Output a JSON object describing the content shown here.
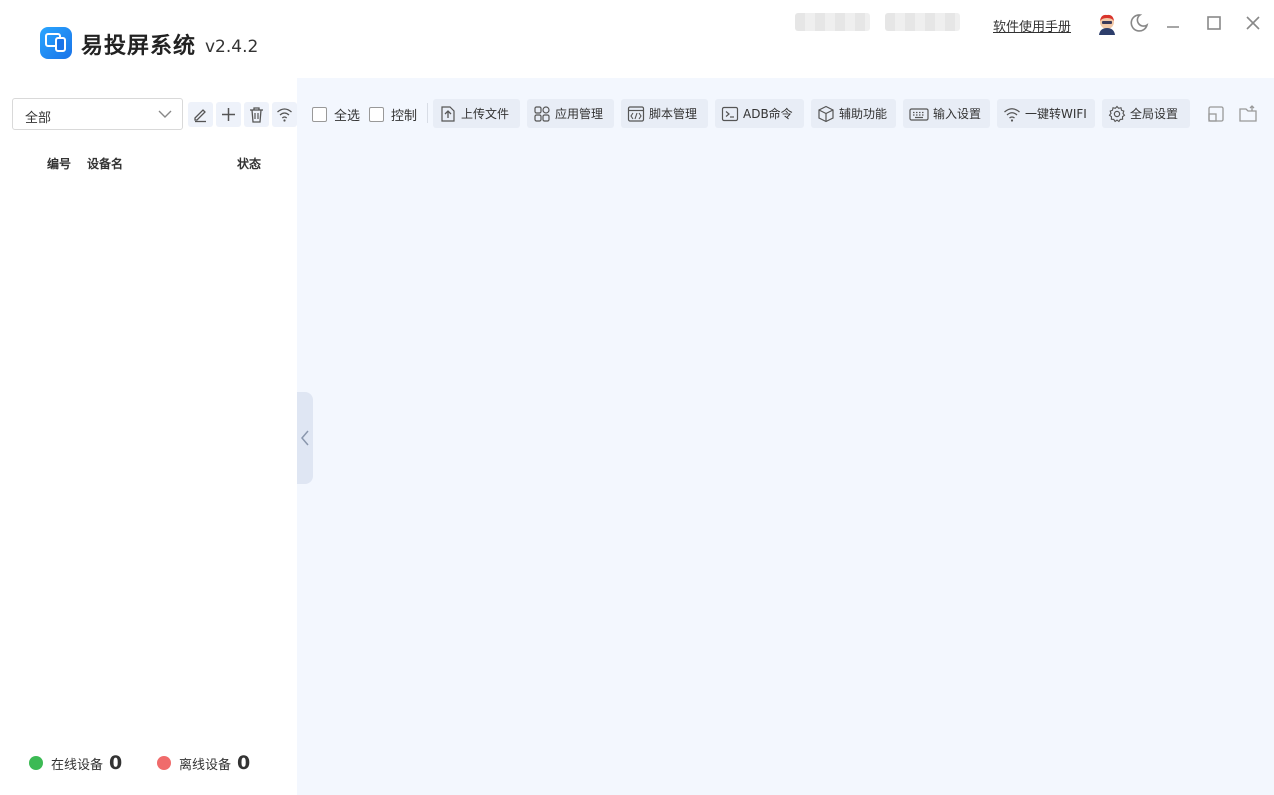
{
  "app": {
    "title": "易投屏系统",
    "version": "v2.4.2"
  },
  "header": {
    "manual_link": "软件使用手册",
    "icons": [
      "avatar-icon",
      "theme-toggle-icon",
      "minimize-icon",
      "maximize-icon",
      "close-icon"
    ]
  },
  "sidebar": {
    "group_select": {
      "value": "全部"
    },
    "action_icons": [
      "edit-icon",
      "add-icon",
      "delete-icon",
      "wifi-icon"
    ],
    "table_headers": {
      "number": "编号",
      "device_name": "设备名",
      "status": "状态"
    },
    "stats": {
      "online_label": "在线设备",
      "online_count": "0",
      "offline_label": "离线设备",
      "offline_count": "0"
    }
  },
  "toolbar": {
    "select_all": "全选",
    "control": "控制",
    "buttons": {
      "upload": "上传文件",
      "apps": "应用管理",
      "script": "脚本管理",
      "adb": "ADB命令",
      "assist": "辅助功能",
      "input": "输入设置",
      "wifi": "一键转WIFI",
      "settings": "全局设置"
    }
  },
  "colors": {
    "accent": "#1a73e8",
    "online": "#3cba54",
    "offline": "#f06b6b",
    "main_bg": "#f3f7fe",
    "button_bg": "#e8edf6"
  }
}
